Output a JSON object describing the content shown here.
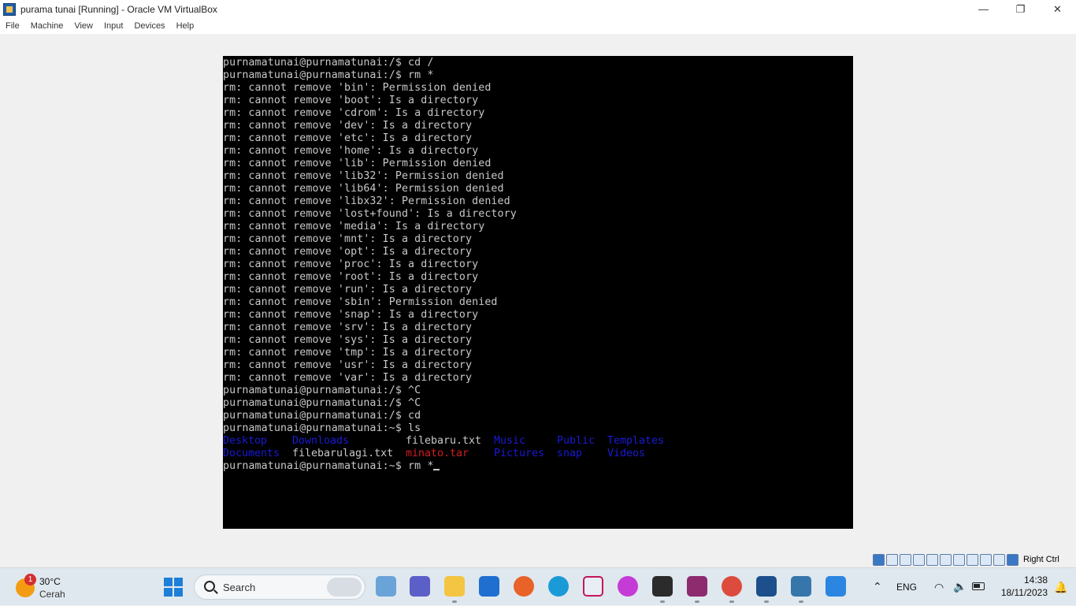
{
  "window": {
    "title": "purama tunai [Running] - Oracle VM VirtualBox",
    "controls": {
      "minimize": "—",
      "maximize": "❐",
      "close": "✕"
    }
  },
  "menu": [
    "File",
    "Machine",
    "View",
    "Input",
    "Devices",
    "Help"
  ],
  "terminal": {
    "lines": [
      "purnamatunai@purnamatunai:/$ cd /",
      "purnamatunai@purnamatunai:/$ rm *",
      "rm: cannot remove 'bin': Permission denied",
      "rm: cannot remove 'boot': Is a directory",
      "rm: cannot remove 'cdrom': Is a directory",
      "rm: cannot remove 'dev': Is a directory",
      "rm: cannot remove 'etc': Is a directory",
      "rm: cannot remove 'home': Is a directory",
      "rm: cannot remove 'lib': Permission denied",
      "rm: cannot remove 'lib32': Permission denied",
      "rm: cannot remove 'lib64': Permission denied",
      "rm: cannot remove 'libx32': Permission denied",
      "rm: cannot remove 'lost+found': Is a directory",
      "rm: cannot remove 'media': Is a directory",
      "rm: cannot remove 'mnt': Is a directory",
      "rm: cannot remove 'opt': Is a directory",
      "rm: cannot remove 'proc': Is a directory",
      "rm: cannot remove 'root': Is a directory",
      "rm: cannot remove 'run': Is a directory",
      "rm: cannot remove 'sbin': Permission denied",
      "rm: cannot remove 'snap': Is a directory",
      "rm: cannot remove 'srv': Is a directory",
      "rm: cannot remove 'sys': Is a directory",
      "rm: cannot remove 'tmp': Is a directory",
      "rm: cannot remove 'usr': Is a directory",
      "rm: cannot remove 'var': Is a directory",
      "purnamatunai@purnamatunai:/$ ^C",
      "purnamatunai@purnamatunai:/$ ^C",
      "purnamatunai@purnamatunai:/$ cd",
      "purnamatunai@purnamatunai:~$ ls"
    ],
    "ls_row1": [
      {
        "name": "Desktop",
        "kind": "dir"
      },
      {
        "name": "Downloads",
        "kind": "dir"
      },
      {
        "name": "filebaru.txt",
        "kind": "file"
      },
      {
        "name": "Music",
        "kind": "dir"
      },
      {
        "name": "Public",
        "kind": "dir"
      },
      {
        "name": "Templates",
        "kind": "dir"
      }
    ],
    "ls_row2": [
      {
        "name": "Documents",
        "kind": "dir"
      },
      {
        "name": "filebarulagi.txt",
        "kind": "file"
      },
      {
        "name": "minato.tar",
        "kind": "archive"
      },
      {
        "name": "Pictures",
        "kind": "dir"
      },
      {
        "name": "snap",
        "kind": "dir"
      },
      {
        "name": "Videos",
        "kind": "dir"
      }
    ],
    "current_prompt": "purnamatunai@purnamatunai:~$ rm *",
    "colors": {
      "text": "#c8c8c8",
      "dir": "#1a1ad6",
      "archive": "#d11e1e",
      "background": "#000000"
    }
  },
  "statusbar": {
    "host_key": "Right Ctrl"
  },
  "taskbar": {
    "weather": {
      "badge": "1",
      "temp": "30°C",
      "condition": "Cerah"
    },
    "search_label": "Search",
    "apps": [
      "pre-app",
      "teams",
      "file-explorer",
      "store-app",
      "firefox",
      "edge",
      "snipping-tool",
      "wps",
      "terminal",
      "winrar",
      "chrome",
      "virtualbox",
      "python-idle",
      "photos"
    ],
    "tray": {
      "lang": "ENG",
      "time": "14:38",
      "date": "18/11/2023"
    }
  }
}
